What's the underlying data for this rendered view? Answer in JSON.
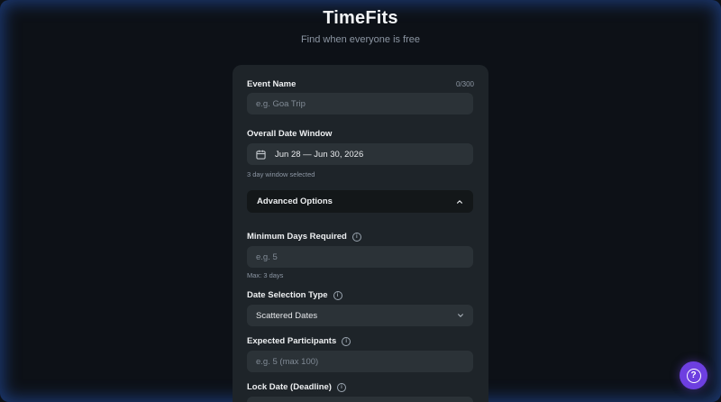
{
  "app": {
    "title": "TimeFits",
    "subtitle": "Find when everyone is free"
  },
  "form": {
    "event_name": {
      "label": "Event Name",
      "counter": "0/300",
      "placeholder": "e.g. Goa Trip",
      "value": ""
    },
    "date_window": {
      "label": "Overall Date Window",
      "value": "Jun 28 — Jun 30, 2026",
      "hint": "3 day window selected",
      "icon": "calendar-icon"
    },
    "advanced": {
      "label": "Advanced Options",
      "expanded": true,
      "icon": "chevron-up-icon"
    },
    "min_days": {
      "label": "Minimum Days Required",
      "placeholder": "e.g. 5",
      "hint": "Max: 3 days",
      "info_icon": "i"
    },
    "date_selection_type": {
      "label": "Date Selection Type",
      "selected": "Scattered Dates",
      "info_icon": "i",
      "icon": "chevron-down-icon"
    },
    "participants": {
      "label": "Expected Participants",
      "placeholder": "e.g. 5 (max 100)",
      "info_icon": "i"
    },
    "lock_date": {
      "label": "Lock Date (Deadline)",
      "info_icon": "i"
    }
  },
  "help": {
    "glyph": "?",
    "icon": "help-icon"
  },
  "colors": {
    "background": "#0d1117",
    "card": "#1e2429",
    "field": "#2b3237",
    "accent": "#6d3fe0"
  }
}
